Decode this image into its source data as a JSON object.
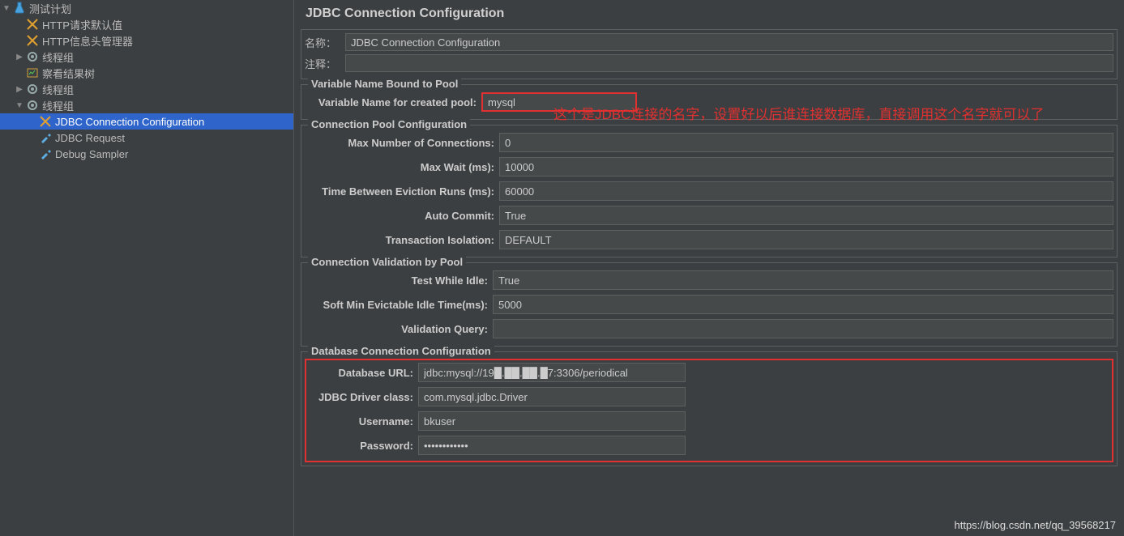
{
  "tree": {
    "root": "测试计划",
    "http_defaults": "HTTP请求默认值",
    "http_header_mgr": "HTTP信息头管理器",
    "thread_group_1": "线程组",
    "view_results_tree": "察看结果树",
    "thread_group_2": "线程组",
    "thread_group_3": "线程组",
    "jdbc_conn_config": "JDBC Connection Configuration",
    "jdbc_request": "JDBC Request",
    "debug_sampler": "Debug Sampler"
  },
  "panel": {
    "title": "JDBC Connection Configuration",
    "name_label": "名称：",
    "name_value": "JDBC Connection Configuration",
    "comment_label": "注释：",
    "comment_value": ""
  },
  "varname": {
    "group_title": "Variable Name Bound to Pool",
    "label": "Variable Name for created pool:",
    "value": "mysql"
  },
  "pool": {
    "group_title": "Connection Pool Configuration",
    "max_conn_label": "Max Number of Connections:",
    "max_conn_value": "0",
    "max_wait_label": "Max Wait (ms):",
    "max_wait_value": "10000",
    "eviction_label": "Time Between Eviction Runs (ms):",
    "eviction_value": "60000",
    "auto_commit_label": "Auto Commit:",
    "auto_commit_value": "True",
    "isolation_label": "Transaction Isolation:",
    "isolation_value": "DEFAULT"
  },
  "validation": {
    "group_title": "Connection Validation by Pool",
    "test_idle_label": "Test While Idle:",
    "test_idle_value": "True",
    "soft_min_label": "Soft Min Evictable Idle Time(ms):",
    "soft_min_value": "5000",
    "query_label": "Validation Query:",
    "query_value": ""
  },
  "db": {
    "group_title": "Database Connection Configuration",
    "url_label": "Database URL:",
    "url_value": "jdbc:mysql://19█.██.██.█7:3306/periodical",
    "driver_label": "JDBC Driver class:",
    "driver_value": "com.mysql.jdbc.Driver",
    "user_label": "Username:",
    "user_value": "bkuser",
    "pass_label": "Password:",
    "pass_value": "••••••••••••"
  },
  "annotation": "这个是JDBC连接的名字，设置好以后谁连接数据库，直接调用这个名字就可以了",
  "watermark": "https://blog.csdn.net/qq_39568217"
}
